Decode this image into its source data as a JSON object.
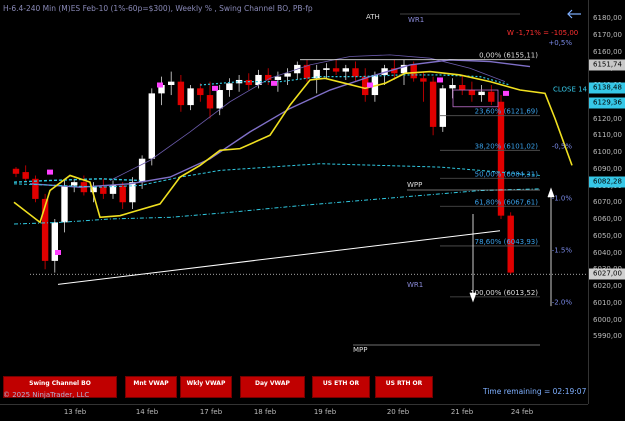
{
  "header": {
    "title": "H-6.4-240 Min (M)ES Feb-10  (1%-60p=$300), Weekly % , Swing Channel BO, PB-fp"
  },
  "annotations": {
    "ath": "ATH",
    "wr1_top": "WR1",
    "wr1_bottom": "WR1",
    "wpp": "WPP",
    "mpp": "MPP",
    "pnl": "W -1,71% = -105,00",
    "close": "CLOSE 14"
  },
  "fib_levels": [
    {
      "label": "0,00% (6155,11)",
      "price": 6155.11
    },
    {
      "label": "23,60% (6121,69)",
      "price": 6121.69
    },
    {
      "label": "38,20% (6101,02)",
      "price": 6101.02
    },
    {
      "label": "50,00% (6084,31)",
      "price": 6084.31
    },
    {
      "label": "61,80% (6067,61)",
      "price": 6067.61
    },
    {
      "label": "78,60% (6043,93)",
      "price": 6043.93
    },
    {
      "label": "100,00% (6013,52)",
      "price": 6013.52
    }
  ],
  "pct_labels": [
    {
      "text": "+0,5%",
      "price": 6164
    },
    {
      "text": "-0,5%",
      "price": 6102
    },
    {
      "text": "-1.0%",
      "price": 6071
    },
    {
      "text": "-1.5%",
      "price": 6040
    },
    {
      "text": "-2.0%",
      "price": 6009
    }
  ],
  "price_axis": {
    "ticks": [
      "6180,00",
      "6170,00",
      "6160,00",
      "6150,00",
      "6140,00",
      "6130,00",
      "6120,00",
      "6110,00",
      "6100,00",
      "6090,00",
      "6080,00",
      "6070,00",
      "6060,00",
      "6050,00",
      "6040,00",
      "6030,00",
      "6020,00",
      "6010,00",
      "6000,00",
      "5990,00"
    ],
    "badges": [
      {
        "text": "6151,74",
        "price": 6151.74,
        "color": "#c8c8c8"
      },
      {
        "text": "6138,48",
        "price": 6138.48,
        "color": "#36c8e8"
      },
      {
        "text": "6129,36",
        "price": 6129.36,
        "color": "#36c8e8"
      },
      {
        "text": "6082,28",
        "price": 6082.28,
        "color": "#36c8e8"
      },
      {
        "text": "6027,00",
        "price": 6027.0,
        "color": "#d0d0d0"
      }
    ]
  },
  "time_axis": {
    "ticks": [
      "13 feb",
      "14 feb",
      "17 feb",
      "18 feb",
      "19 feb",
      "20 feb",
      "21 feb",
      "24 feb"
    ]
  },
  "toolbar": {
    "swing_channel": "Swing Channel BO",
    "mnt_vwap": "Mnt VWAP",
    "wkly_vwap": "Wkly VWAP",
    "day_vwap": "Day VWAP",
    "us_eth_or": "US ETH OR",
    "us_rth_or": "US RTH OR"
  },
  "footer": {
    "copyright": "© 2025 NinjaTrader, LLC",
    "time_remaining": "Time remaining = 02:19:07"
  },
  "colors": {
    "up": "#ffffff",
    "down": "#e00000",
    "yellow": "#f0e020",
    "cyan": "#30c8e0",
    "lavender": "#9a8ad8",
    "magenta": "#ff40ff"
  },
  "chart_data": {
    "type": "candlestick",
    "ylim": [
      5985,
      6185
    ],
    "candles": [
      [
        6090,
        6091,
        6085,
        6087
      ],
      [
        6088,
        6092,
        6082,
        6084
      ],
      [
        6084,
        6086,
        6070,
        6072
      ],
      [
        6072,
        6075,
        6030,
        6035
      ],
      [
        6035,
        6060,
        6028,
        6058
      ],
      [
        6058,
        6083,
        6052,
        6080
      ],
      [
        6080,
        6084,
        6076,
        6082
      ],
      [
        6082,
        6086,
        6074,
        6076
      ],
      [
        6076,
        6082,
        6070,
        6079
      ],
      [
        6079,
        6084,
        6072,
        6075
      ],
      [
        6075,
        6083,
        6072,
        6080
      ],
      [
        6080,
        6082,
        6066,
        6070
      ],
      [
        6070,
        6085,
        6066,
        6082
      ],
      [
        6082,
        6098,
        6078,
        6096
      ],
      [
        6096,
        6138,
        6092,
        6135
      ],
      [
        6135,
        6145,
        6128,
        6140
      ],
      [
        6140,
        6148,
        6134,
        6142
      ],
      [
        6142,
        6146,
        6124,
        6128
      ],
      [
        6128,
        6140,
        6125,
        6138
      ],
      [
        6138,
        6141,
        6130,
        6134
      ],
      [
        6134,
        6142,
        6120,
        6126
      ],
      [
        6126,
        6140,
        6122,
        6137
      ],
      [
        6137,
        6144,
        6133,
        6141
      ],
      [
        6141,
        6146,
        6136,
        6143
      ],
      [
        6143,
        6147,
        6137,
        6140
      ],
      [
        6140,
        6149,
        6138,
        6146
      ],
      [
        6146,
        6150,
        6140,
        6143
      ],
      [
        6143,
        6148,
        6136,
        6145
      ],
      [
        6145,
        6150,
        6140,
        6147
      ],
      [
        6147,
        6154,
        6143,
        6152
      ],
      [
        6152,
        6155,
        6142,
        6144
      ],
      [
        6144,
        6152,
        6135,
        6149
      ],
      [
        6149,
        6153,
        6144,
        6150
      ],
      [
        6150,
        6155,
        6146,
        6148
      ],
      [
        6148,
        6152,
        6143,
        6150
      ],
      [
        6150,
        6154,
        6142,
        6145
      ],
      [
        6145,
        6150,
        6130,
        6134
      ],
      [
        6134,
        6148,
        6130,
        6146
      ],
      [
        6146,
        6152,
        6140,
        6150
      ],
      [
        6150,
        6155,
        6143,
        6147
      ],
      [
        6147,
        6155,
        6140,
        6152
      ],
      [
        6152,
        6154,
        6142,
        6144
      ],
      [
        6144,
        6148,
        6130,
        6142
      ],
      [
        6142,
        6145,
        6110,
        6115
      ],
      [
        6115,
        6140,
        6112,
        6138
      ],
      [
        6138,
        6144,
        6132,
        6140
      ],
      [
        6140,
        6146,
        6134,
        6137
      ],
      [
        6137,
        6142,
        6130,
        6134
      ],
      [
        6134,
        6140,
        6130,
        6136
      ],
      [
        6136,
        6140,
        6128,
        6130
      ],
      [
        6130,
        6134,
        6060,
        6062
      ],
      [
        6062,
        6064,
        6027,
        6028
      ]
    ]
  }
}
